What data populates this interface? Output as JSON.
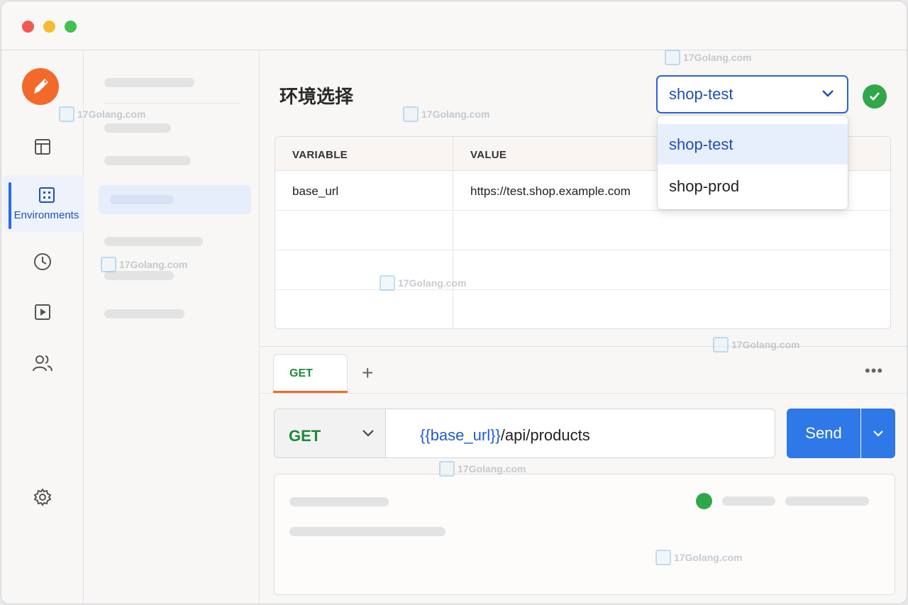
{
  "nav": {
    "active_label": "Environments",
    "icons": [
      "logo-icon",
      "workspace-icon",
      "environments-icon",
      "history-icon",
      "runner-icon",
      "team-icon",
      "settings-icon"
    ]
  },
  "env": {
    "title": "环境选择",
    "selected": "shop-test",
    "options": [
      "shop-test",
      "shop-prod"
    ],
    "table": {
      "headers": [
        "VARIABLE",
        "VALUE"
      ],
      "rows": [
        [
          "base_url",
          "https://test.shop.example.com"
        ]
      ]
    }
  },
  "request": {
    "tab_label": "GET",
    "add_tab": "+",
    "more": "•••",
    "method": "GET",
    "url_variable": "{{base_url}}",
    "url_path": "/api/products",
    "send_label": "Send"
  },
  "watermark": "17Golang.com",
  "colors": {
    "accent": "#2f78e8",
    "logo": "#f26a2b",
    "method_green": "#1d8a3a",
    "success": "#2fa84a",
    "tab_underline": "#ee6a2c"
  }
}
